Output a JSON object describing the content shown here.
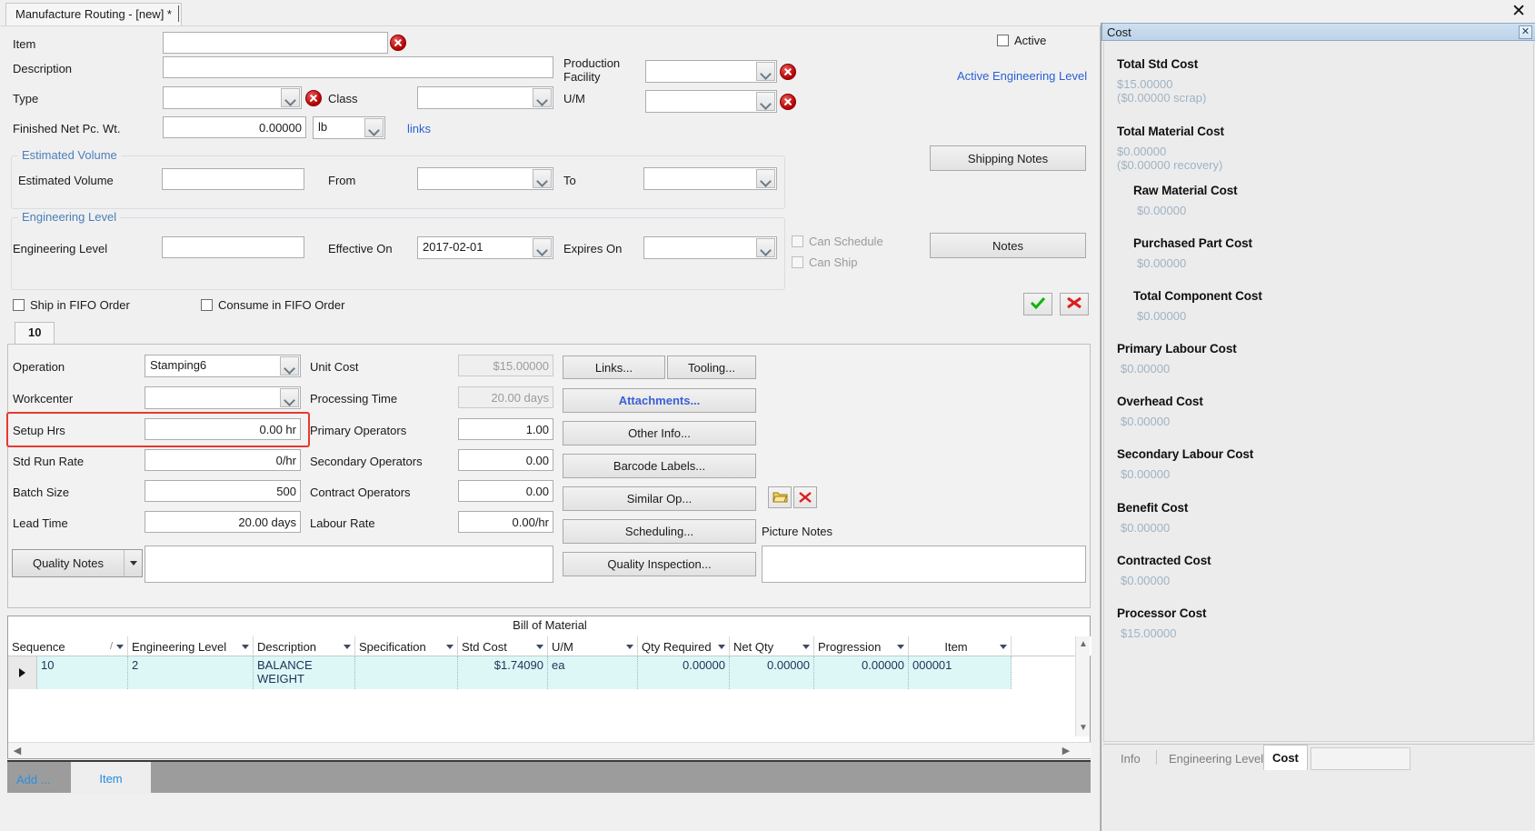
{
  "window": {
    "tab_title": "Manufacture Routing - [new] *",
    "close_label": "✕"
  },
  "header_form": {
    "item_label": "Item",
    "item_value": "",
    "description_label": "Description",
    "description_value": "",
    "type_label": "Type",
    "type_value": "",
    "class_label": "Class",
    "class_value": "",
    "finished_net_label": "Finished Net Pc. Wt.",
    "finished_net_value": "0.00000",
    "uom_small_value": "lb",
    "links_label": "links",
    "production_facility_label": "Production\nFacility",
    "production_facility_value": "",
    "um_label": "U/M",
    "um_value": "",
    "active_label": "Active",
    "active_engineering_level_label": "Active Engineering Level",
    "shipping_notes_label": "Shipping Notes",
    "notes_label": "Notes"
  },
  "estimated_volume": {
    "group_title": "Estimated Volume",
    "field_label": "Estimated Volume",
    "field_value": "",
    "from_label": "From",
    "from_value": "",
    "to_label": "To",
    "to_value": ""
  },
  "engineering_level": {
    "group_title": "Engineering Level",
    "field_label": "Engineering Level",
    "field_value": "",
    "effective_on_label": "Effective On",
    "effective_on_value": "2017-02-01",
    "expires_on_label": "Expires On",
    "expires_on_value": "",
    "can_schedule_label": "Can Schedule",
    "can_ship_label": "Can Ship"
  },
  "fifo": {
    "ship_fifo_label": "Ship in FIFO Order",
    "consume_fifo_label": "Consume in FIFO Order"
  },
  "operation": {
    "tab_label": "10",
    "operation_label": "Operation",
    "operation_value": "Stamping6",
    "workcenter_label": "Workcenter",
    "workcenter_value": "",
    "setup_hrs_label": "Setup Hrs",
    "setup_hrs_value": "0.00 hr",
    "std_run_rate_label": "Std Run Rate",
    "std_run_rate_value": "0/hr",
    "batch_size_label": "Batch Size",
    "batch_size_value": "500",
    "lead_time_label": "Lead Time",
    "lead_time_value": "20.00 days",
    "unit_cost_label": "Unit Cost",
    "unit_cost_value": "$15.00000",
    "processing_time_label": "Processing Time",
    "processing_time_value": "20.00 days",
    "primary_operators_label": "Primary Operators",
    "primary_operators_value": "1.00",
    "secondary_operators_label": "Secondary Operators",
    "secondary_operators_value": "0.00",
    "contract_operators_label": "Contract Operators",
    "contract_operators_value": "0.00",
    "labour_rate_label": "Labour Rate",
    "labour_rate_value": "0.00/hr",
    "buttons": {
      "links": "Links...",
      "tooling": "Tooling...",
      "attachments": "Attachments...",
      "other_info": "Other Info...",
      "barcode_labels": "Barcode Labels...",
      "similar_op": "Similar Op...",
      "scheduling": "Scheduling...",
      "quality_inspection": "Quality Inspection..."
    },
    "quality_notes_label": "Quality Notes",
    "quality_notes_value": "",
    "picture_notes_label": "Picture Notes",
    "picture_notes_value": ""
  },
  "bom": {
    "title": "Bill of Material",
    "columns": [
      "Sequence",
      "Engineering Level",
      "Description",
      "Specification",
      "Std Cost",
      "U/M",
      "Qty Required",
      "Net Qty",
      "Progression",
      "Item"
    ],
    "rows": [
      {
        "sequence": "10",
        "engineering_level": "2",
        "description": "BALANCE WEIGHT",
        "specification": "",
        "std_cost": "$1.74090",
        "um": "ea",
        "qty_required": "0.00000",
        "net_qty": "0.00000",
        "progression": "0.00000",
        "item": "000001"
      }
    ]
  },
  "bottom_bar": {
    "add_label": "Add ...",
    "item_tab_label": "Item"
  },
  "cost_panel": {
    "title": "Cost",
    "close_label": "✕",
    "items": [
      {
        "name": "Total Std Cost",
        "value": "$15.00000",
        "sub": "($0.00000 scrap)",
        "indent": 0
      },
      {
        "name": "Total Material Cost",
        "value": "$0.00000",
        "sub": "($0.00000 recovery)",
        "indent": 0
      },
      {
        "name": "Raw Material Cost",
        "value": "$0.00000",
        "sub": "",
        "indent": 1
      },
      {
        "name": "Purchased Part Cost",
        "value": "$0.00000",
        "sub": "",
        "indent": 1
      },
      {
        "name": "Total Component Cost",
        "value": "$0.00000",
        "sub": "",
        "indent": 1
      },
      {
        "name": "Primary Labour Cost",
        "value": "$0.00000",
        "sub": "",
        "indent": 0
      },
      {
        "name": "Overhead Cost",
        "value": "$0.00000",
        "sub": "",
        "indent": 0
      },
      {
        "name": "Secondary Labour Cost",
        "value": "$0.00000",
        "sub": "",
        "indent": 0
      },
      {
        "name": "Benefit Cost",
        "value": "$0.00000",
        "sub": "",
        "indent": 0
      },
      {
        "name": "Contracted Cost",
        "value": "$0.00000",
        "sub": "",
        "indent": 0
      },
      {
        "name": "Processor Cost",
        "value": "$15.00000",
        "sub": "",
        "indent": 0
      }
    ],
    "tabs": [
      {
        "label": "Info",
        "selected": false
      },
      {
        "label": "Engineering Levels",
        "selected": false
      },
      {
        "label": "Cost",
        "selected": true
      }
    ]
  },
  "colors": {
    "accent_blue": "#2a5fd4",
    "error_red": "#b20000",
    "highlight_red": "#e8392f",
    "row_highlight": "#ddf7f7",
    "cost_value": "#9fb3c4"
  }
}
